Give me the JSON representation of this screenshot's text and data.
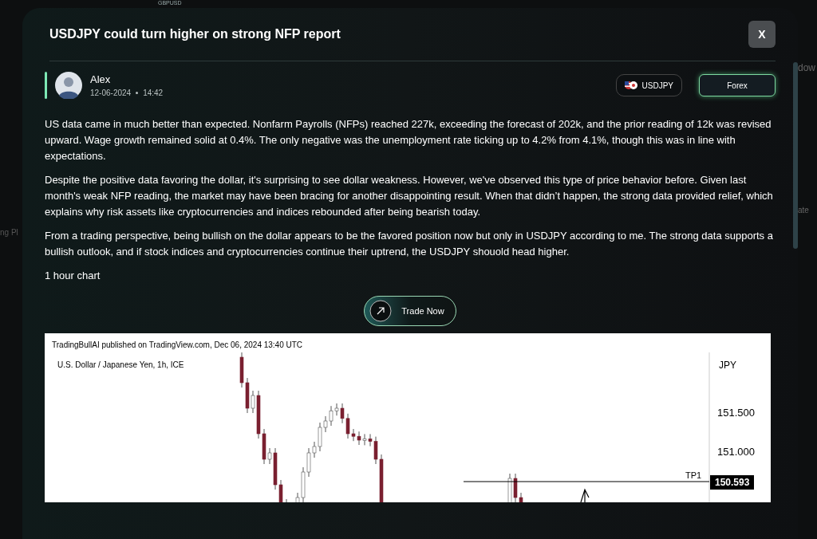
{
  "background": {
    "top_label": "GBPUSD",
    "right_label": "dow",
    "right_column_label": "ate",
    "left_label": "ng Pl"
  },
  "modal": {
    "title": "USDJPY could turn higher on strong NFP report",
    "close_label": "X",
    "author": {
      "name": "Alex",
      "date": "12-06-2024",
      "time": "14:42"
    },
    "tags": [
      {
        "label": "USDJPY",
        "kind": "symbol",
        "selected": false
      },
      {
        "label": "Forex",
        "kind": "category",
        "selected": true
      }
    ],
    "paragraphs": [
      "US data came in much better than expected. Nonfarm Payrolls (NFPs) reached 227k, exceeding the forecast of 202k, and the prior reading of 12k was revised upward. Wage growth remained solid at 0.4%. The only negative was the unemployment rate ticking up to 4.2% from 4.1%, though this was in line with expectations.",
      "Despite the positive data favoring the dollar, it's surprising to see dollar weakness. However, we've observed this type of price behavior before. Given last month's weak NFP reading, the market may have been bracing for another disappointing result. When that didn’t happen, the strong data provided relief, which explains why risk assets like cryptocurrencies and indices rebounded after being bearish today.",
      "From a trading perspective, being bullish on the dollar appears to be the favored position now but only in USDJPY according to me. The strong data supports a bullish outlook, and if stock indices and cryptocurrencies continue their uptrend, the USDJPY shouold head higher.",
      "1 hour chart"
    ],
    "trade_button": "Trade Now",
    "chart_image": {
      "publisher": "TradingBullAI published on TradingView.com, Dec 06, 2024 13:40 UTC",
      "symbol": "U.S. Dollar / Japanese Yen, 1h, ICE",
      "currency": "JPY",
      "price_labels": [
        "151.500",
        "151.000"
      ],
      "level_label": "TP1",
      "level_price": "150.593"
    }
  }
}
